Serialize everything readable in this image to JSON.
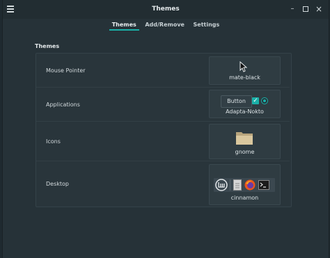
{
  "window": {
    "title": "Themes"
  },
  "tabs": [
    {
      "label": "Themes"
    },
    {
      "label": "Add/Remove"
    },
    {
      "label": "Settings"
    }
  ],
  "section": {
    "title": "Themes"
  },
  "rows": [
    {
      "label": "Mouse Pointer",
      "value": "mate-black",
      "icon": "cursor-icon"
    },
    {
      "label": "Applications",
      "value": "Adapta-Nokto",
      "preview_button": "Button"
    },
    {
      "label": "Icons",
      "value": "gnome",
      "icon": "folder-icon"
    },
    {
      "label": "Desktop",
      "value": "cinnamon",
      "icons": [
        "mint-menu-icon",
        "files-icon",
        "firefox-icon",
        "terminal-icon"
      ]
    }
  ],
  "colors": {
    "accent": "#1ab0a8",
    "background": "#263238",
    "titlebar": "#222d32"
  }
}
